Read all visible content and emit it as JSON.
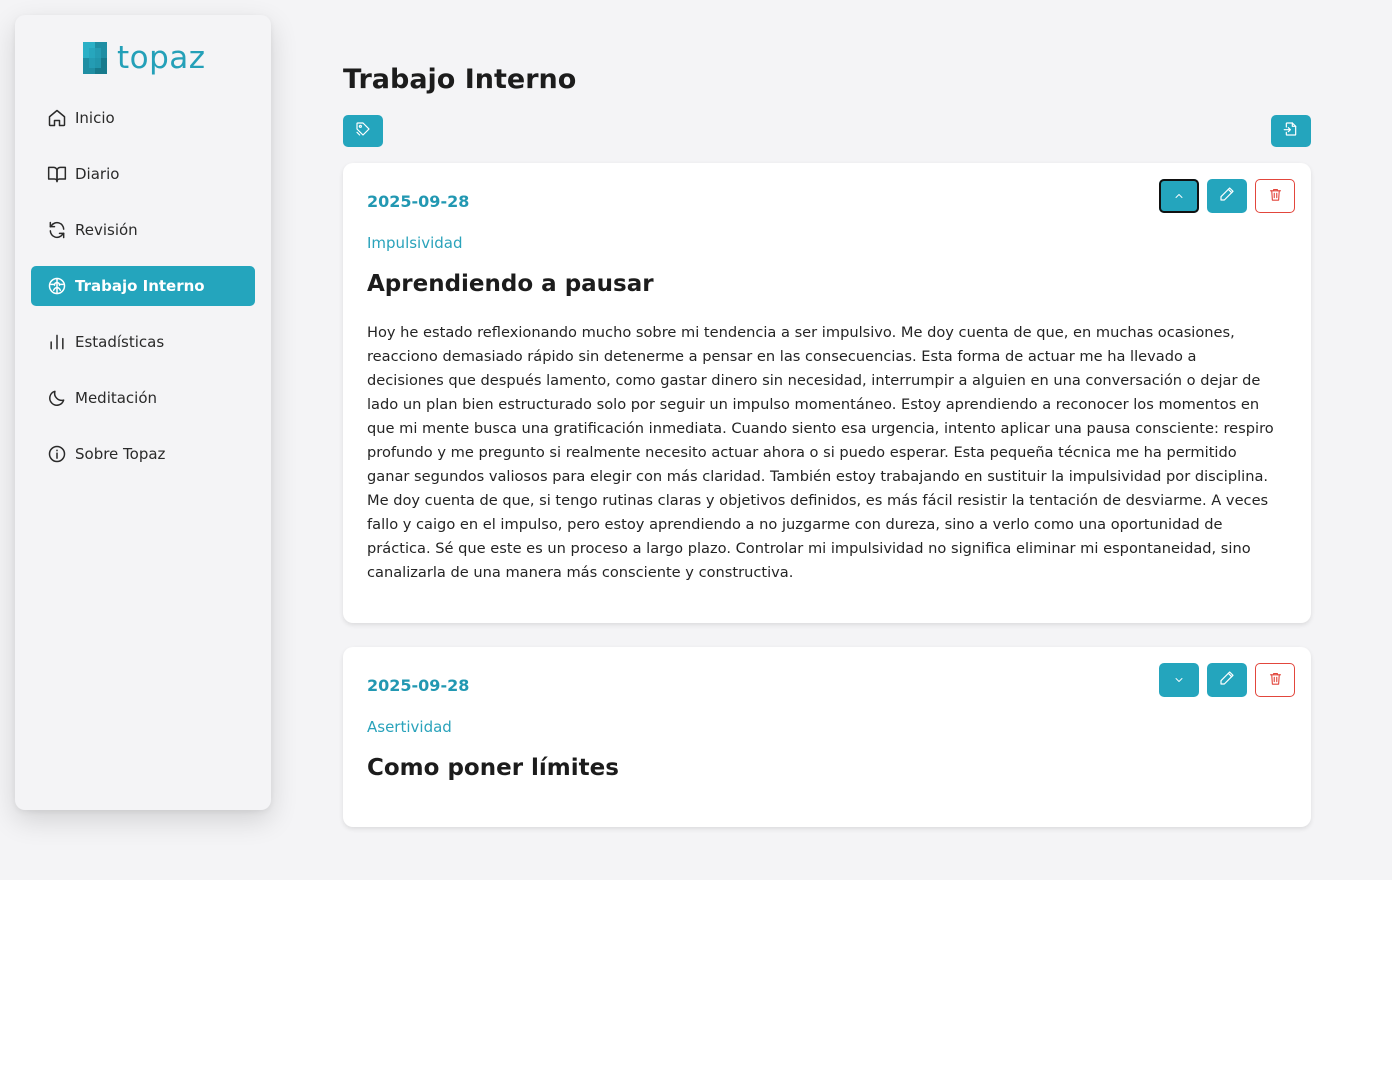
{
  "brand": {
    "name": "topaz",
    "accent": "#24a5bd",
    "logo_icon": "gem-icon"
  },
  "sidebar": {
    "items": [
      {
        "label": "Inicio",
        "icon": "home-icon",
        "active": false
      },
      {
        "label": "Diario",
        "icon": "book-icon",
        "active": false
      },
      {
        "label": "Revisión",
        "icon": "refresh-icon",
        "active": false
      },
      {
        "label": "Trabajo Interno",
        "icon": "brain-icon",
        "active": true
      },
      {
        "label": "Estadísticas",
        "icon": "bar-chart-icon",
        "active": false
      },
      {
        "label": "Meditación",
        "icon": "moon-icon",
        "active": false
      },
      {
        "label": "Sobre Topaz",
        "icon": "info-icon",
        "active": false
      }
    ]
  },
  "main": {
    "title": "Trabajo Interno",
    "toolbar": {
      "tags_icon": "tags-icon",
      "import_icon": "file-import-icon"
    },
    "entries": [
      {
        "date": "2025-09-28",
        "category": "Impulsividad",
        "title": "Aprendiendo a pausar",
        "expanded": true,
        "body": "Hoy he estado reflexionando mucho sobre mi tendencia a ser impulsivo. Me doy cuenta de que, en muchas ocasiones, reacciono demasiado rápido sin detenerme a pensar en las consecuencias. Esta forma de actuar me ha llevado a decisiones que después lamento, como gastar dinero sin necesidad, interrumpir a alguien en una conversación o dejar de lado un plan bien estructurado solo por seguir un impulso momentáneo. Estoy aprendiendo a reconocer los momentos en que mi mente busca una gratificación inmediata. Cuando siento esa urgencia, intento aplicar una pausa consciente: respiro profundo y me pregunto si realmente necesito actuar ahora o si puedo esperar. Esta pequeña técnica me ha permitido ganar segundos valiosos para elegir con más claridad. También estoy trabajando en sustituir la impulsividad por disciplina. Me doy cuenta de que, si tengo rutinas claras y objetivos definidos, es más fácil resistir la tentación de desviarme. A veces fallo y caigo en el impulso, pero estoy aprendiendo a no juzgarme con dureza, sino a verlo como una oportunidad de práctica. Sé que este es un proceso a largo plazo. Controlar mi impulsividad no significa eliminar mi espontaneidad, sino canalizarla de una manera más consciente y constructiva."
      },
      {
        "date": "2025-09-28",
        "category": "Asertividad",
        "title": "Como poner límites",
        "expanded": false
      }
    ]
  }
}
